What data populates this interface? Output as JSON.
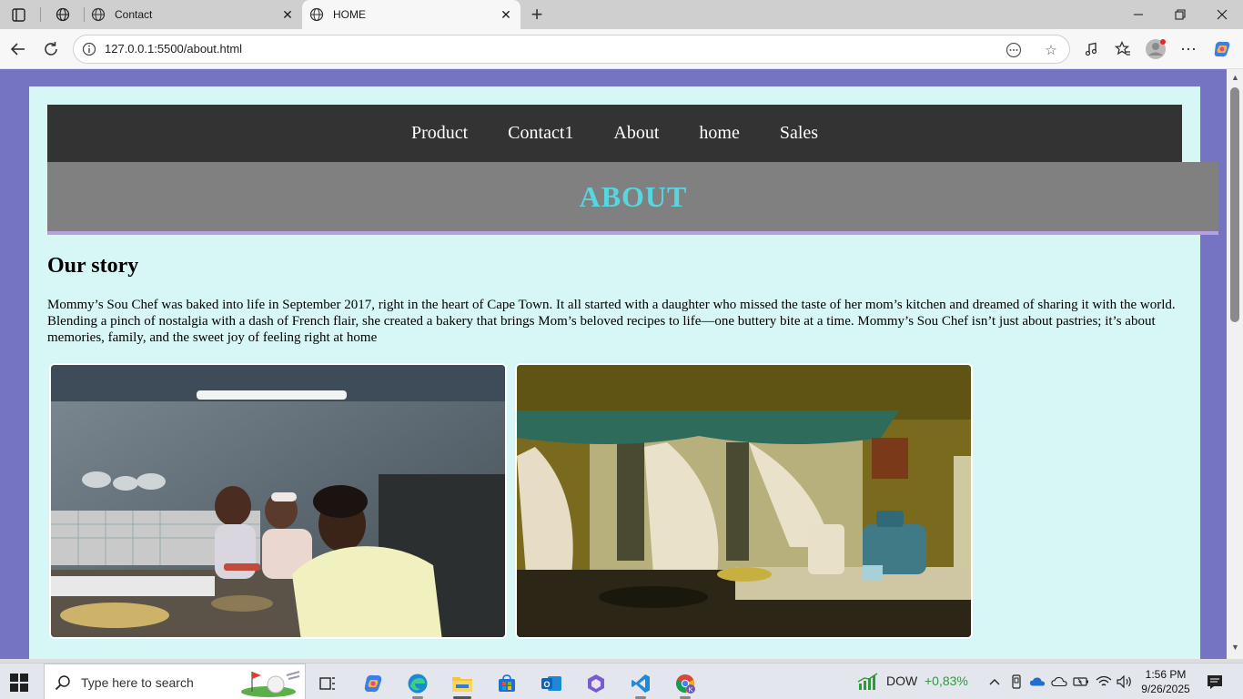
{
  "browser": {
    "tabs": [
      {
        "title": "Contact",
        "active": false
      },
      {
        "title": "HOME",
        "active": true
      }
    ],
    "url": "127.0.0.1:5500/about.html"
  },
  "page": {
    "nav": [
      "Product",
      "Contact1",
      "About",
      "home",
      "Sales"
    ],
    "banner_title": "ABOUT",
    "story_heading": "Our story",
    "story_text": "Mommy’s Sou Chef was baked into life in September 2017, right in the heart of Cape Town. It all started with a daughter who missed the taste of her mom’s kitchen and dreamed of sharing it with the world. Blending a pinch of nostalgia with a dash of French flair, she created a bakery that brings Mom’s beloved recipes to life—one buttery bite at a time. Mommy’s Sou Chef isn’t just about pastries; it’s about memories, family, and the sweet joy of feeling right at home"
  },
  "taskbar": {
    "search_placeholder": "Type here to search",
    "stock_name": "DOW",
    "stock_change": "+0,83%",
    "time": "1:56 PM",
    "date": "9/26/2025"
  },
  "colors": {
    "page_bg": "#7474c2",
    "content_bg": "#d6f7f5",
    "nav_bg": "#333333",
    "banner_bg": "#808080",
    "banner_text": "#57d6e0",
    "banner_border": "#b7a0e0",
    "stock_positive": "#2e9a3a"
  },
  "icons": [
    "tab-actions-icon",
    "workspaces-icon",
    "globe-icon",
    "close-icon",
    "plus-icon",
    "minimize-icon",
    "maximize-icon",
    "back-arrow-icon",
    "refresh-icon",
    "site-info-icon",
    "read-aloud-icon",
    "favorite-star-icon",
    "media-icon",
    "favorites-icon",
    "profile-avatar-icon",
    "more-icon",
    "copilot-icon",
    "windows-start-icon",
    "search-icon",
    "task-view-icon",
    "edge-icon",
    "file-explorer-icon",
    "store-icon",
    "outlook-icon",
    "vscode-icon",
    "chrome-icon"
  ]
}
